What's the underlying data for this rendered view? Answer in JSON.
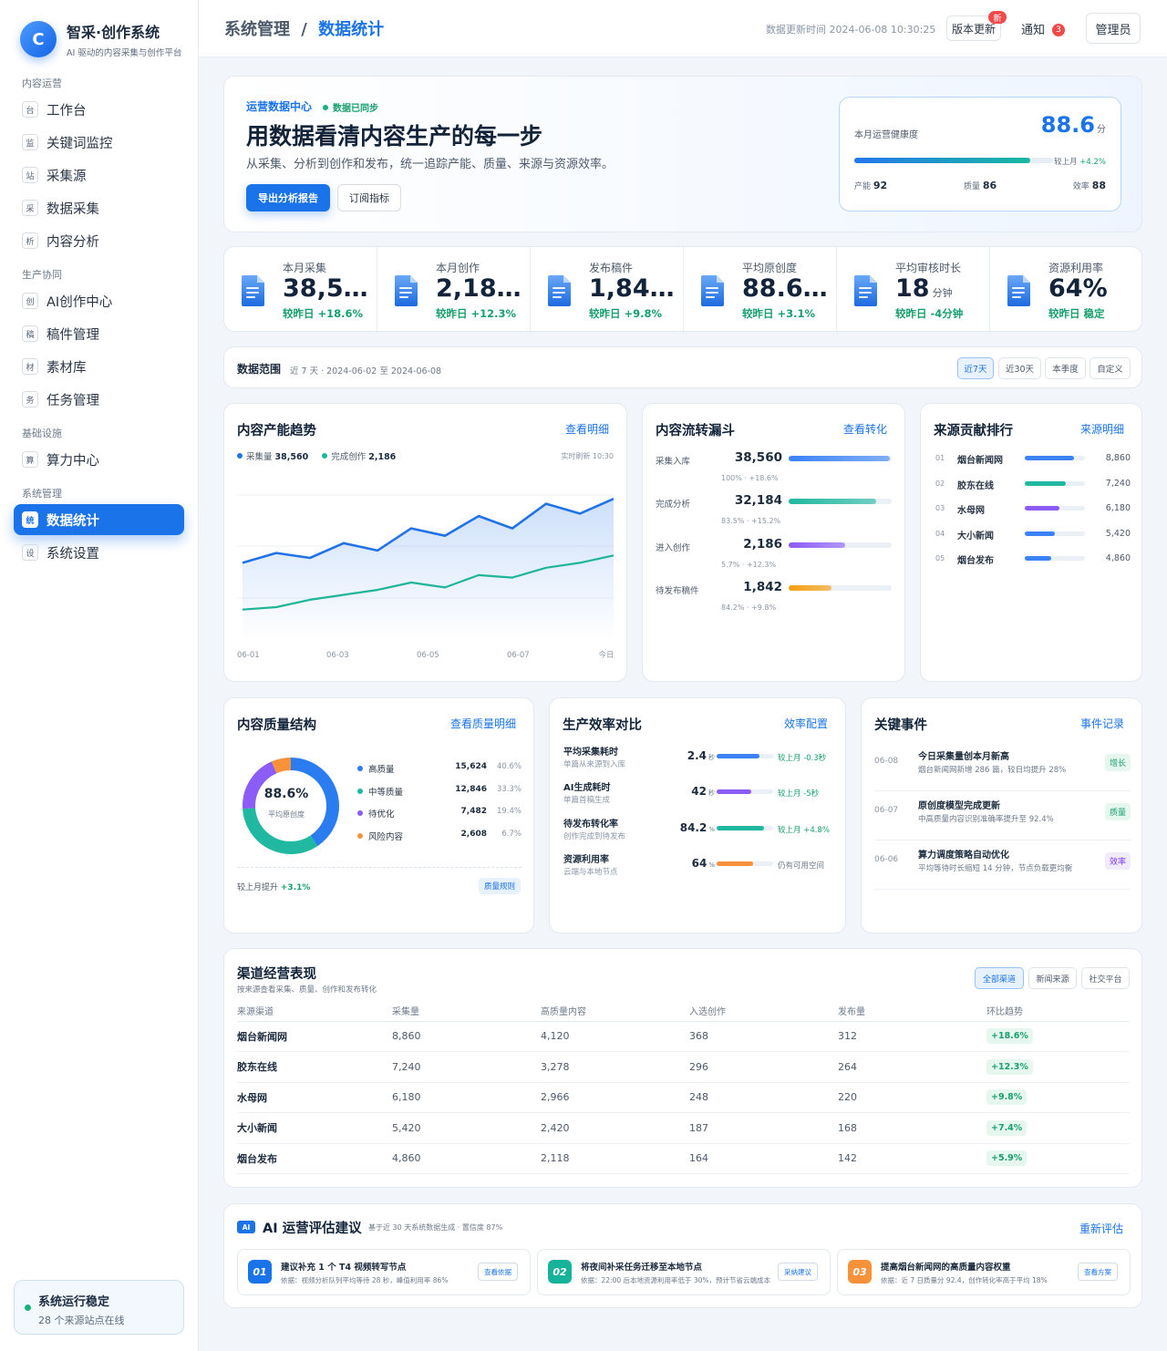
{
  "brand": {
    "logo": "C",
    "title": "智采·创作系统",
    "subtitle": "AI 驱动的内容采集与创作平台"
  },
  "nav": {
    "groups": [
      "内容运营",
      "生产协同",
      "基础设施",
      "系统管理"
    ],
    "items": [
      {
        "icon": "台",
        "label": "工作台"
      },
      {
        "icon": "监",
        "label": "关键词监控"
      },
      {
        "icon": "站",
        "label": "采集源"
      },
      {
        "icon": "采",
        "label": "数据采集"
      },
      {
        "icon": "析",
        "label": "内容分析"
      },
      {
        "icon": "创",
        "label": "AI创作中心"
      },
      {
        "icon": "稿",
        "label": "稿件管理"
      },
      {
        "icon": "材",
        "label": "素材库"
      },
      {
        "icon": "务",
        "label": "任务管理"
      },
      {
        "icon": "算",
        "label": "算力中心"
      },
      {
        "icon": "统",
        "label": "数据统计"
      },
      {
        "icon": "设",
        "label": "系统设置"
      }
    ]
  },
  "status": {
    "title": "系统运行稳定",
    "sub": "28 个来源站点在线"
  },
  "topbar": {
    "crumb_parent": "系统管理",
    "crumb_sep": "/",
    "crumb_current": "数据统计",
    "update_time": "数据更新时间 2024-06-08 10:30:25",
    "version": "版本更新",
    "version_badge": "新",
    "notice": "通知",
    "notice_count": "3",
    "admin": "管理员"
  },
  "hero": {
    "tag": "运营数据中心",
    "sync": "数据已同步",
    "title": "用数据看清内容生产的每一步",
    "sub": "从采集、分析到创作和发布，统一追踪产能、质量、来源与资源效率。",
    "btn_primary": "导出分析报告",
    "btn_secondary": "订阅指标",
    "health": {
      "label": "本月运营健康度",
      "value": "88.6",
      "unit": "分",
      "progress": 0.886,
      "cmp_label": "较上月",
      "cmp_value": "+4.2%",
      "items": [
        {
          "label": "产能",
          "value": "92"
        },
        {
          "label": "质量",
          "value": "86"
        },
        {
          "label": "效率",
          "value": "88"
        }
      ]
    }
  },
  "kpis": [
    {
      "label": "本月采集",
      "value": "38,5…",
      "unit": "",
      "change": "较昨日 +18.6%"
    },
    {
      "label": "本月创作",
      "value": "2,186",
      "unit": "篇",
      "change": "较昨日 +12.3%"
    },
    {
      "label": "发布稿件",
      "value": "1,842",
      "unit": "篇",
      "change": "较昨日 +9.8%"
    },
    {
      "label": "平均原创度",
      "value": "88.6%",
      "unit": "",
      "change": "较昨日 +3.1%"
    },
    {
      "label": "平均审核时长",
      "value": "18",
      "unit": "分钟",
      "change": "较昨日 -4分钟"
    },
    {
      "label": "资源利用率",
      "value": "64%",
      "unit": "",
      "change": "较昨日 稳定"
    }
  ],
  "range": {
    "title": "数据范围",
    "sub": "近 7 天 · 2024-06-02 至 2024-06-08",
    "options": [
      "近7天",
      "近30天",
      "本季度",
      "自定义"
    ]
  },
  "trend": {
    "title": "内容产能趋势",
    "link": "查看明细",
    "legend": [
      {
        "label": "采集量",
        "value": "38,560"
      },
      {
        "label": "完成创作",
        "value": "2,186"
      }
    ],
    "refresh": "实时刷新 10:30"
  },
  "chart_data": {
    "type": "area",
    "title": "内容产能趋势",
    "x": [
      "06-01",
      "",
      "06-03",
      "",
      "06-05",
      "",
      "06-07",
      "",
      "今日"
    ],
    "x_ticks": [
      "06-01",
      "06-03",
      "06-05",
      "06-07",
      "今日"
    ],
    "series": [
      {
        "name": "采集量",
        "values": [
          48,
          52,
          50,
          56,
          53,
          62,
          59,
          67,
          62,
          72,
          68,
          74
        ]
      },
      {
        "name": "完成创作",
        "values": [
          29,
          30,
          33,
          35,
          37,
          40,
          38,
          43,
          42,
          46,
          48,
          51
        ]
      }
    ],
    "note": "relative values estimated; y-axis unlabeled"
  },
  "funnel": {
    "title": "内容流转漏斗",
    "link": "查看转化",
    "items": [
      {
        "label": "采集入库",
        "value": "38,560",
        "sub": "100% · +18.6%",
        "pct": 0.98,
        "color": "#3b82f6"
      },
      {
        "label": "完成分析",
        "value": "32,184",
        "sub": "83.5% · +15.2%",
        "pct": 0.85,
        "color": "#20b8a0"
      },
      {
        "label": "进入创作",
        "value": "2,186",
        "sub": "5.7% · +12.3%",
        "pct": 0.55,
        "color": "#8b5cf6"
      },
      {
        "label": "待发布稿件",
        "value": "1,842",
        "sub": "84.2% · +9.8%",
        "pct": 0.42,
        "color": "#f59e0b"
      }
    ]
  },
  "sources": {
    "title": "来源贡献排行",
    "link": "来源明细",
    "items": [
      {
        "n": "01",
        "name": "烟台新闻网",
        "value": "8,860",
        "pct": 0.82,
        "color": "#3b82f6"
      },
      {
        "n": "02",
        "name": "胶东在线",
        "value": "7,240",
        "pct": 0.68,
        "color": "#20b8a0"
      },
      {
        "n": "03",
        "name": "水母网",
        "value": "6,180",
        "pct": 0.58,
        "color": "#8b5cf6"
      },
      {
        "n": "04",
        "name": "大小新闻",
        "value": "5,420",
        "pct": 0.5,
        "color": "#3b82f6"
      },
      {
        "n": "05",
        "name": "烟台发布",
        "value": "4,860",
        "pct": 0.44,
        "color": "#3b82f6"
      }
    ]
  },
  "quality": {
    "title": "内容质量结构",
    "link": "查看质量明细",
    "center_value": "88.6%",
    "center_label": "平均原创度",
    "items": [
      {
        "name": "高质量",
        "value": "15,624",
        "pct": "40.6%",
        "share": 40.6,
        "color": "#2b7cf0"
      },
      {
        "name": "中等质量",
        "value": "12,846",
        "pct": "33.3%",
        "share": 33.3,
        "color": "#20b8a0"
      },
      {
        "name": "待优化",
        "value": "7,482",
        "pct": "19.4%",
        "share": 19.4,
        "color": "#8b5cf6"
      },
      {
        "name": "风险内容",
        "value": "2,608",
        "pct": "6.7%",
        "share": 6.7,
        "color": "#f7923a"
      }
    ],
    "foot_label": "较上月提升",
    "foot_value": "+3.1%",
    "tag": "质量规则"
  },
  "efficiency": {
    "title": "生产效率对比",
    "link": "效率配置",
    "items": [
      {
        "title": "平均采集耗时",
        "sub": "单篇从来源到入库",
        "value": "2.4",
        "unit": "秒",
        "pct": 0.75,
        "color": "#3b82f6",
        "change": "较上月 -0.3秒"
      },
      {
        "title": "AI生成耗时",
        "sub": "单篇首稿生成",
        "value": "42",
        "unit": "秒",
        "pct": 0.62,
        "color": "#8b5cf6",
        "change": "较上月 -5秒"
      },
      {
        "title": "待发布转化率",
        "sub": "创作完成到待发布",
        "value": "84.2",
        "unit": "%",
        "pct": 0.84,
        "color": "#20b8a0",
        "change": "较上月 +4.8%"
      },
      {
        "title": "资源利用率",
        "sub": "云端与本地节点",
        "value": "64",
        "unit": "%",
        "pct": 0.64,
        "color": "#f7923a",
        "change": "仍有可用空间"
      }
    ]
  },
  "events": {
    "title": "关键事件",
    "link": "事件记录",
    "items": [
      {
        "date": "06-08",
        "title": "今日采集量创本月新高",
        "sub": "烟台新闻网新增 286 篇，较日均提升 28%",
        "tag": "增长",
        "tag_bg": "#e6f7ef",
        "tag_fg": "#18a06e"
      },
      {
        "date": "06-07",
        "title": "原创度模型完成更新",
        "sub": "中高质量内容识别准确率提升至 92.4%",
        "tag": "质量",
        "tag_bg": "#e6f7ef",
        "tag_fg": "#18a06e"
      },
      {
        "date": "06-06",
        "title": "算力调度策略自动优化",
        "sub": "平均等待时长缩短 14 分钟，节点负载更均衡",
        "tag": "效率",
        "tag_bg": "#f1ebfe",
        "tag_fg": "#7c3aed"
      }
    ]
  },
  "channels": {
    "title": "渠道经营表现",
    "sub": "按来源查看采集、质量、创作和发布转化",
    "filters": [
      "全部渠道",
      "新闻来源",
      "社交平台"
    ],
    "columns": [
      "来源渠道",
      "采集量",
      "高质量内容",
      "入选创作",
      "发布量",
      "环比趋势"
    ],
    "rows": [
      [
        "烟台新闻网",
        "8,860",
        "4,120",
        "368",
        "312",
        "+18.6%"
      ],
      [
        "胶东在线",
        "7,240",
        "3,278",
        "296",
        "264",
        "+12.3%"
      ],
      [
        "水母网",
        "6,180",
        "2,966",
        "248",
        "220",
        "+9.8%"
      ],
      [
        "大小新闻",
        "5,420",
        "2,420",
        "187",
        "168",
        "+7.4%"
      ],
      [
        "烟台发布",
        "4,860",
        "2,118",
        "164",
        "142",
        "+5.9%"
      ]
    ]
  },
  "ai": {
    "badge": "AI",
    "title": "AI 运营评估建议",
    "sub": "基于近 30 天系统数据生成 · 置信度 87%",
    "link": "重新评估",
    "items": [
      {
        "n": "01",
        "title": "建议补充 1 个 T4 视频转写节点",
        "sub": "依据：视频分析队列平均等待 28 秒，峰值利用率 86%",
        "btn": "查看依据",
        "color": "#1a73e8"
      },
      {
        "n": "02",
        "title": "将夜间补采任务迁移至本地节点",
        "sub": "依据：22:00 后本地资源利用率低于 30%，预计节省云端成本",
        "btn": "采纳建议",
        "color": "#16b39a"
      },
      {
        "n": "03",
        "title": "提高烟台新闻网的高质量内容权重",
        "sub": "依据：近 7 日质量分 92.4，创作转化率高于平均 18%",
        "btn": "查看方案",
        "color": "#f7923a"
      }
    ]
  }
}
